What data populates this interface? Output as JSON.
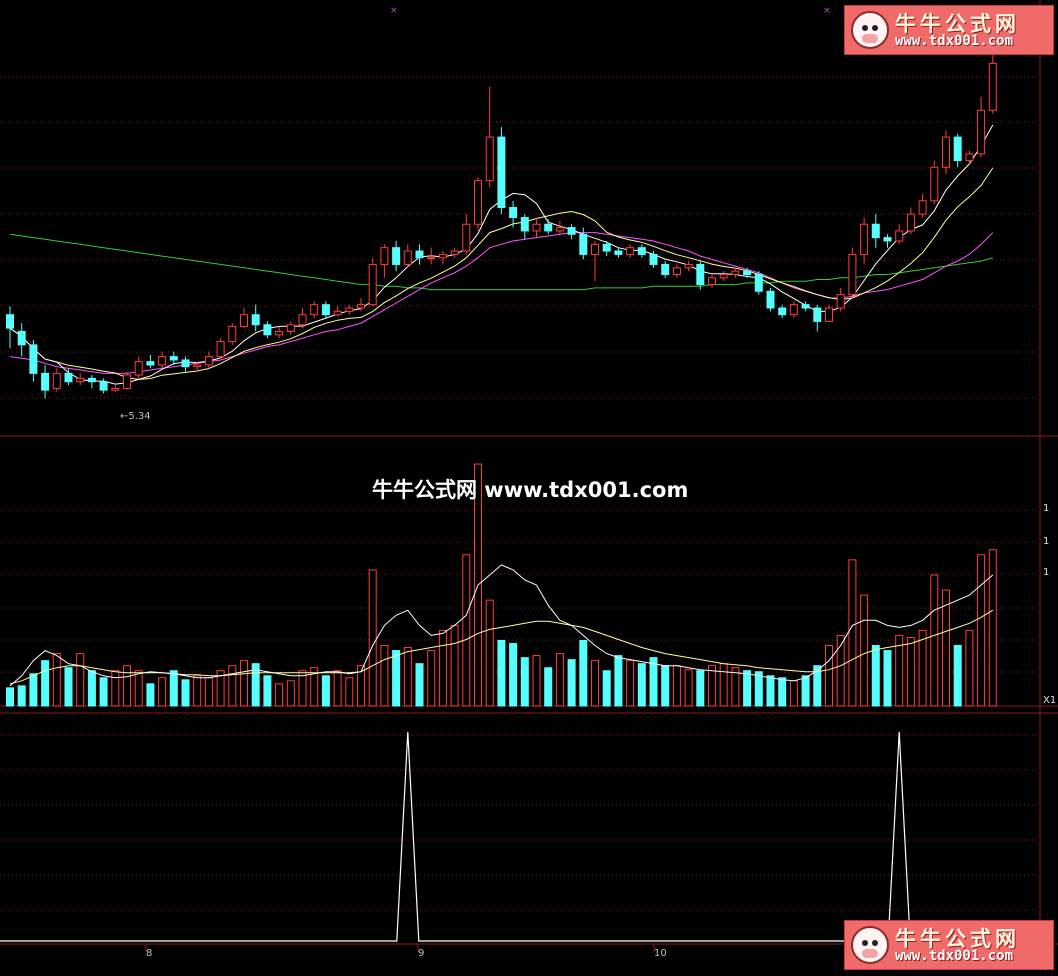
{
  "logo": {
    "title": "牛牛公式网",
    "url": "www.tdx001.com"
  },
  "watermark": "牛牛公式网 www.tdx001.com",
  "colors": {
    "up": "#ff3c3c",
    "down": "#55ffff",
    "ma5": "#ffffff",
    "ma10": "#ffff9a",
    "ma20": "#ff55ff",
    "ma60": "#33cc33",
    "grid": "#8b1a1a",
    "signal": "#ffffff"
  },
  "chart_data": [
    {
      "type": "candlestick",
      "low_label": "←5.34",
      "candles": [
        [
          5.8,
          5.72,
          5.85,
          5.6
        ],
        [
          5.7,
          5.62,
          5.75,
          5.55
        ],
        [
          5.62,
          5.45,
          5.65,
          5.4
        ],
        [
          5.45,
          5.35,
          5.5,
          5.3
        ],
        [
          5.36,
          5.45,
          5.48,
          5.34
        ],
        [
          5.45,
          5.4,
          5.48,
          5.38
        ],
        [
          5.4,
          5.42,
          5.45,
          5.38
        ],
        [
          5.42,
          5.4,
          5.44,
          5.36
        ],
        [
          5.4,
          5.35,
          5.42,
          5.33
        ],
        [
          5.35,
          5.36,
          5.38,
          5.34
        ],
        [
          5.36,
          5.44,
          5.46,
          5.35
        ],
        [
          5.44,
          5.52,
          5.55,
          5.42
        ],
        [
          5.52,
          5.5,
          5.56,
          5.48
        ],
        [
          5.5,
          5.55,
          5.58,
          5.48
        ],
        [
          5.55,
          5.53,
          5.58,
          5.5
        ],
        [
          5.53,
          5.49,
          5.55,
          5.46
        ],
        [
          5.49,
          5.5,
          5.52,
          5.46
        ],
        [
          5.5,
          5.55,
          5.58,
          5.48
        ],
        [
          5.55,
          5.64,
          5.66,
          5.54
        ],
        [
          5.64,
          5.73,
          5.75,
          5.62
        ],
        [
          5.73,
          5.8,
          5.84,
          5.72
        ],
        [
          5.8,
          5.74,
          5.86,
          5.7
        ],
        [
          5.74,
          5.68,
          5.76,
          5.66
        ],
        [
          5.68,
          5.7,
          5.73,
          5.66
        ],
        [
          5.7,
          5.74,
          5.76,
          5.68
        ],
        [
          5.74,
          5.8,
          5.84,
          5.72
        ],
        [
          5.8,
          5.86,
          5.88,
          5.78
        ],
        [
          5.86,
          5.8,
          5.88,
          5.78
        ],
        [
          5.8,
          5.82,
          5.85,
          5.79
        ],
        [
          5.82,
          5.84,
          5.86,
          5.8
        ],
        [
          5.84,
          5.86,
          5.9,
          5.82
        ],
        [
          5.86,
          6.1,
          6.14,
          5.85
        ],
        [
          6.1,
          6.2,
          6.22,
          6.02
        ],
        [
          6.2,
          6.1,
          6.24,
          6.06
        ],
        [
          6.1,
          6.18,
          6.22,
          6.08
        ],
        [
          6.18,
          6.14,
          6.22,
          6.1
        ],
        [
          6.14,
          6.14,
          6.2,
          6.1
        ],
        [
          6.14,
          6.16,
          6.18,
          6.1
        ],
        [
          6.16,
          6.18,
          6.2,
          6.14
        ],
        [
          6.18,
          6.34,
          6.4,
          6.16
        ],
        [
          6.34,
          6.6,
          6.62,
          6.3
        ],
        [
          6.6,
          6.86,
          7.16,
          6.56
        ],
        [
          6.86,
          6.44,
          6.92,
          6.4
        ],
        [
          6.44,
          6.38,
          6.48,
          6.32
        ],
        [
          6.38,
          6.3,
          6.4,
          6.25
        ],
        [
          6.3,
          6.34,
          6.38,
          6.26
        ],
        [
          6.34,
          6.3,
          6.37,
          6.28
        ],
        [
          6.3,
          6.32,
          6.36,
          6.28
        ],
        [
          6.32,
          6.28,
          6.34,
          6.25
        ],
        [
          6.28,
          6.16,
          6.32,
          6.13
        ],
        [
          6.16,
          6.22,
          6.24,
          6.0
        ],
        [
          6.22,
          6.18,
          6.24,
          6.15
        ],
        [
          6.18,
          6.16,
          6.2,
          6.14
        ],
        [
          6.16,
          6.2,
          6.22,
          6.14
        ],
        [
          6.2,
          6.16,
          6.22,
          6.14
        ],
        [
          6.16,
          6.1,
          6.18,
          6.08
        ],
        [
          6.1,
          6.04,
          6.12,
          6.02
        ],
        [
          6.04,
          6.08,
          6.1,
          6.02
        ],
        [
          6.08,
          6.1,
          6.12,
          6.06
        ],
        [
          6.1,
          5.98,
          6.12,
          5.95
        ],
        [
          5.98,
          6.02,
          6.04,
          5.96
        ],
        [
          6.02,
          6.04,
          6.06,
          6.0
        ],
        [
          6.04,
          6.06,
          6.08,
          6.02
        ],
        [
          6.06,
          6.04,
          6.08,
          6.02
        ],
        [
          6.04,
          5.94,
          6.06,
          5.92
        ],
        [
          5.94,
          5.84,
          5.96,
          5.82
        ],
        [
          5.84,
          5.8,
          5.86,
          5.78
        ],
        [
          5.8,
          5.86,
          5.88,
          5.78
        ],
        [
          5.86,
          5.84,
          5.88,
          5.82
        ],
        [
          5.84,
          5.76,
          5.86,
          5.7
        ],
        [
          5.76,
          5.84,
          5.86,
          5.76
        ],
        [
          5.84,
          5.92,
          5.96,
          5.82
        ],
        [
          5.92,
          6.16,
          6.2,
          5.9
        ],
        [
          6.16,
          6.34,
          6.38,
          6.1
        ],
        [
          6.34,
          6.26,
          6.4,
          6.2
        ],
        [
          6.26,
          6.24,
          6.28,
          6.2
        ],
        [
          6.24,
          6.3,
          6.34,
          6.22
        ],
        [
          6.3,
          6.4,
          6.44,
          6.28
        ],
        [
          6.4,
          6.48,
          6.52,
          6.38
        ],
        [
          6.48,
          6.68,
          6.72,
          6.46
        ],
        [
          6.68,
          6.86,
          6.9,
          6.64
        ],
        [
          6.86,
          6.72,
          6.88,
          6.68
        ],
        [
          6.72,
          6.76,
          6.78,
          6.7
        ],
        [
          6.76,
          7.02,
          7.1,
          6.74
        ],
        [
          7.02,
          7.3,
          7.4,
          7.0
        ]
      ],
      "ma20": [
        5.55,
        5.54,
        5.53,
        5.51,
        5.49,
        5.48,
        5.47,
        5.46,
        5.45,
        5.45,
        5.45,
        5.46,
        5.47,
        5.48,
        5.49,
        5.5,
        5.51,
        5.52,
        5.53,
        5.55,
        5.57,
        5.59,
        5.61,
        5.62,
        5.64,
        5.66,
        5.68,
        5.7,
        5.71,
        5.73,
        5.75,
        5.79,
        5.83,
        5.87,
        5.91,
        5.95,
        5.99,
        6.02,
        6.05,
        6.09,
        6.14,
        6.2,
        6.22,
        6.24,
        6.25,
        6.26,
        6.27,
        6.28,
        6.29,
        6.29,
        6.29,
        6.28,
        6.27,
        6.26,
        6.25,
        6.24,
        6.22,
        6.2,
        6.18,
        6.15,
        6.13,
        6.11,
        6.09,
        6.07,
        6.05,
        6.02,
        5.99,
        5.96,
        5.94,
        5.92,
        5.9,
        5.9,
        5.91,
        5.93,
        5.94,
        5.95,
        5.97,
        5.99,
        6.01,
        6.05,
        6.09,
        6.12,
        6.16,
        6.22,
        6.29
      ],
      "ma60": [
        6.28,
        6.27,
        6.26,
        6.25,
        6.24,
        6.23,
        6.22,
        6.21,
        6.2,
        6.19,
        6.18,
        6.17,
        6.16,
        6.15,
        6.14,
        6.13,
        6.12,
        6.11,
        6.1,
        6.09,
        6.08,
        6.07,
        6.06,
        6.05,
        6.04,
        6.03,
        6.02,
        6.01,
        6.0,
        5.99,
        5.98,
        5.98,
        5.97,
        5.97,
        5.96,
        5.96,
        5.95,
        5.95,
        5.95,
        5.95,
        5.95,
        5.95,
        5.95,
        5.95,
        5.95,
        5.95,
        5.95,
        5.95,
        5.95,
        5.95,
        5.96,
        5.96,
        5.96,
        5.96,
        5.96,
        5.97,
        5.97,
        5.97,
        5.97,
        5.97,
        5.98,
        5.98,
        5.98,
        5.99,
        5.99,
        5.99,
        6.0,
        6.0,
        6.0,
        6.01,
        6.01,
        6.02,
        6.02,
        6.03,
        6.04,
        6.04,
        6.05,
        6.06,
        6.07,
        6.08,
        6.09,
        6.1,
        6.11,
        6.12,
        6.14
      ]
    },
    {
      "type": "bar",
      "volumes": [
        18,
        20,
        32,
        45,
        52,
        38,
        52,
        35,
        28,
        35,
        40,
        35,
        22,
        28,
        35,
        26,
        30,
        28,
        35,
        40,
        45,
        42,
        30,
        22,
        25,
        35,
        38,
        30,
        35,
        28,
        40,
        135,
        60,
        55,
        58,
        42,
        55,
        75,
        80,
        150,
        240,
        105,
        65,
        62,
        48,
        50,
        38,
        52,
        46,
        65,
        45,
        35,
        50,
        45,
        42,
        48,
        40,
        40,
        36,
        35,
        40,
        42,
        38,
        35,
        34,
        30,
        28,
        25,
        30,
        40,
        60,
        70,
        145,
        110,
        60,
        55,
        70,
        68,
        75,
        130,
        115,
        60,
        75,
        150,
        155
      ],
      "vol_ma_short": [
        20,
        30,
        45,
        55,
        50,
        42,
        40,
        34,
        30,
        28,
        29,
        32,
        34,
        33,
        32,
        30,
        28,
        28,
        30,
        32,
        34,
        36,
        34,
        32,
        30,
        30,
        32,
        34,
        34,
        32,
        34,
        60,
        80,
        90,
        95,
        80,
        70,
        72,
        80,
        90,
        120,
        130,
        140,
        135,
        125,
        120,
        100,
        85,
        80,
        70,
        60,
        52,
        48,
        46,
        44,
        42,
        40,
        40,
        38,
        36,
        35,
        34,
        33,
        32,
        30,
        28,
        26,
        25,
        28,
        35,
        45,
        60,
        80,
        85,
        85,
        80,
        78,
        80,
        85,
        95,
        100,
        105,
        110,
        120,
        130
      ],
      "vol_ma_long": [
        22,
        25,
        30,
        35,
        38,
        40,
        40,
        38,
        36,
        34,
        33,
        33,
        33,
        33,
        32,
        31,
        31,
        30,
        30,
        31,
        32,
        33,
        33,
        33,
        33,
        33,
        33,
        33,
        33,
        33,
        34,
        40,
        46,
        50,
        54,
        56,
        58,
        60,
        62,
        66,
        72,
        76,
        78,
        80,
        82,
        84,
        84,
        82,
        80,
        78,
        74,
        70,
        66,
        62,
        58,
        55,
        52,
        50,
        48,
        46,
        44,
        42,
        41,
        40,
        38,
        37,
        36,
        35,
        34,
        34,
        36,
        40,
        46,
        52,
        56,
        58,
        60,
        62,
        66,
        70,
        74,
        78,
        82,
        88,
        95
      ],
      "y_tick_labels": [
        "1",
        "1",
        "1"
      ]
    },
    {
      "type": "line",
      "signal": [
        0,
        0,
        0,
        0,
        0,
        0,
        0,
        0,
        0,
        0,
        0,
        0,
        0,
        0,
        0,
        0,
        0,
        0,
        0,
        0,
        0,
        0,
        0,
        0,
        0,
        0,
        0,
        0,
        0,
        0,
        0,
        0,
        0,
        0,
        0,
        0,
        0,
        0,
        0,
        0,
        0,
        0,
        0,
        0,
        0,
        0,
        0,
        0,
        0,
        0,
        0,
        0,
        0,
        0,
        0,
        0,
        0,
        0,
        0,
        0,
        0,
        0,
        0,
        0,
        0,
        0,
        0,
        0,
        0,
        0,
        0,
        0,
        0,
        0,
        0,
        0,
        0,
        0,
        0,
        0,
        0,
        0,
        0,
        0,
        0
      ],
      "spikes": [
        34,
        76
      ],
      "x_tick_labels": [
        "8",
        "9",
        "10"
      ]
    }
  ],
  "volume_axis_label": "X1"
}
